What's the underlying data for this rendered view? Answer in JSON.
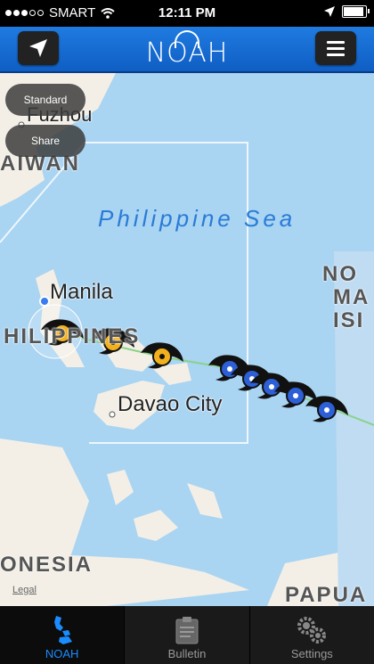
{
  "statusbar": {
    "carrier": "SMART",
    "time": "12:11 PM",
    "signal_bars_filled": 3,
    "signal_bars_total": 5,
    "battery_level": 0.85
  },
  "navbar": {
    "logo": "NOAH"
  },
  "map": {
    "buttons": {
      "standard": "Standard",
      "share": "Share"
    },
    "labels": {
      "fuzhou": "Fuzhou",
      "taiwan": "AIWAN",
      "sea": "Philippine Sea",
      "manila": "Manila",
      "philippines": "HILIPPINES",
      "davao": "Davao City",
      "nomi1": "NO",
      "nomi2": "MA",
      "nomi3": "ISI",
      "indonesia": "ONESIA",
      "papua": "PAPUA",
      "legal": "Legal"
    },
    "colors": {
      "water": "#a9d4f2",
      "land": "#f3efe6",
      "typhoon_yellow": "#f2b11c",
      "typhoon_blue": "#2d5fd6"
    }
  },
  "tabs": [
    {
      "label": "NOAH",
      "icon": "philippines-map-icon",
      "active": true
    },
    {
      "label": "Bulletin",
      "icon": "clipboard-icon",
      "active": false
    },
    {
      "label": "Settings",
      "icon": "gears-icon",
      "active": false
    }
  ]
}
